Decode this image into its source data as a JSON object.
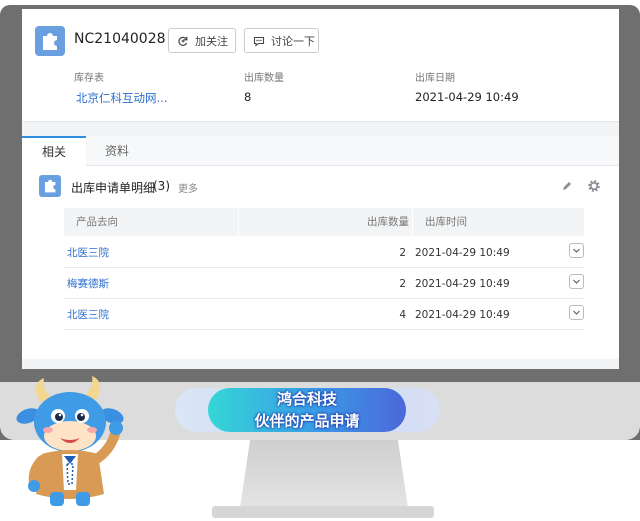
{
  "record": {
    "title": "NC21040028",
    "follow_label": "加关注",
    "discuss_label": "讨论一下",
    "fields": [
      {
        "label": "库存表",
        "value": "北京仁科互动网..."
      },
      {
        "label": "出库数量",
        "value": "8"
      },
      {
        "label": "出库日期",
        "value": "2021-04-29 10:49"
      }
    ]
  },
  "tabs": [
    {
      "label": "相关",
      "active": true
    },
    {
      "label": "资料",
      "active": false
    }
  ],
  "related": {
    "title": "出库申请单明细",
    "count": "(3)",
    "more": "更多",
    "columns": [
      "产品去向",
      "出库数量",
      "出库时间"
    ],
    "rows": [
      {
        "destination": "北医三院",
        "quantity": "2",
        "time": "2021-04-29 10:49"
      },
      {
        "destination": "梅赛德斯",
        "quantity": "2",
        "time": "2021-04-29 10:49"
      },
      {
        "destination": "北医三院",
        "quantity": "4",
        "time": "2021-04-29 10:49"
      }
    ]
  },
  "banner": {
    "line1": "鸿合科技",
    "line2": "伙伴的产品申请"
  },
  "colors": {
    "accent": "#2d8fe0",
    "link": "#2d6fd0",
    "record_icon": "#6a9fe0",
    "monitor_frame": "#6f6f6f"
  },
  "icons": {
    "record": "puzzle-piece-icon",
    "follow": "refresh-plus-icon",
    "discuss": "chat-bubble-icon",
    "edit": "pencil-icon",
    "settings": "gear-icon",
    "row_menu": "chevron-down-icon"
  }
}
